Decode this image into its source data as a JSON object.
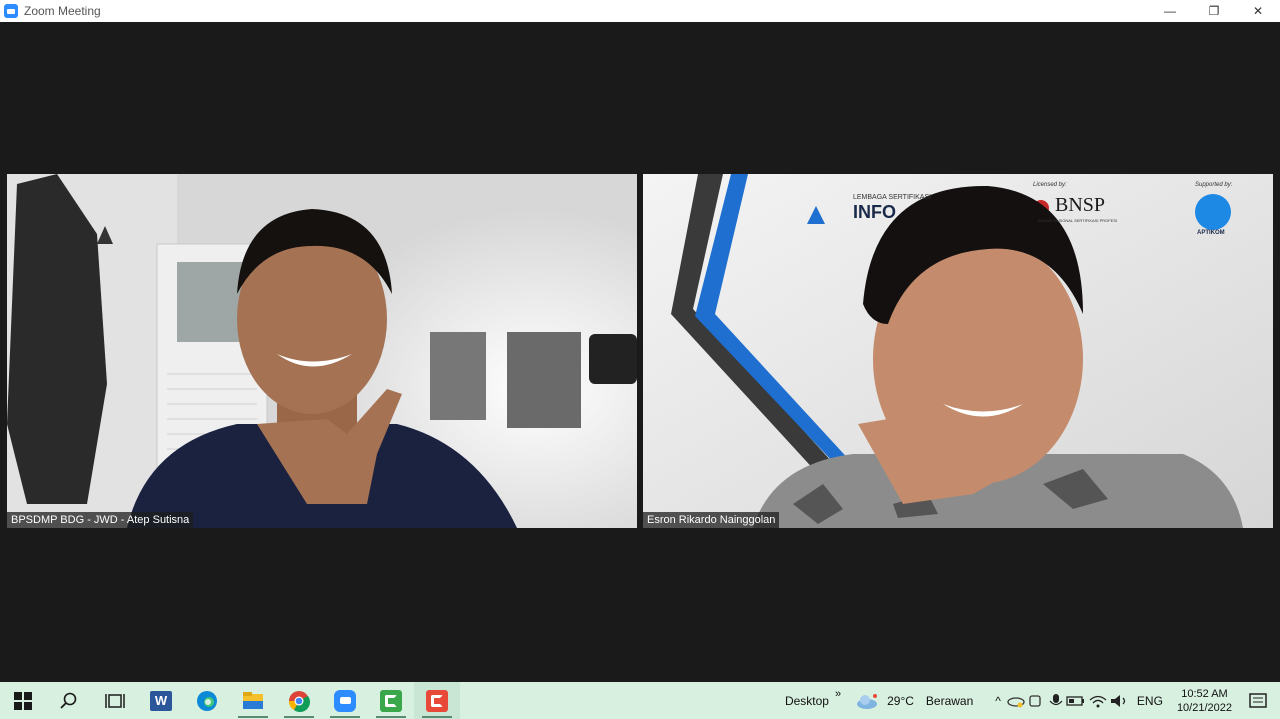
{
  "window": {
    "title": "Zoom Meeting",
    "minimize_glyph": "—",
    "restore_glyph": "❐",
    "close_glyph": "✕"
  },
  "participants": [
    {
      "name": "BPSDMP BDG - JWD - Atep Sutisna"
    },
    {
      "name": "Esron Rikardo Nainggolan"
    }
  ],
  "background_logos": {
    "org_line": "LEMBAGA SERTIFIKASI",
    "org_name": "INFO",
    "licensed_by": "Licensed by:",
    "bnsp": "BNSP",
    "bnsp_sub": "BADAN NASIONAL SERTIFIKASI PROFESI",
    "supported_by": "Supported by:",
    "aptikom": "APTIKOM"
  },
  "taskbar": {
    "apps": [
      "start-icon",
      "search-icon",
      "task-view-icon",
      "word-icon",
      "edge-icon",
      "file-explorer-icon",
      "chrome-icon",
      "zoom-icon",
      "camtasia-green-icon",
      "camtasia-red-icon"
    ],
    "word_letter": "W",
    "desktop_label": "Desktop",
    "chevrons": "»",
    "weather_temp": "29°C",
    "weather_desc": "Berawan",
    "language": "ENG",
    "time": "10:52 AM",
    "date": "10/21/2022"
  },
  "colors": {
    "stage_bg": "#1a1a1a",
    "taskbar_bg": "#d8f0e0",
    "zoom_blue": "#2d8cff",
    "bnsp_red": "#c62828",
    "aptikom_blue": "#1e88e5"
  }
}
